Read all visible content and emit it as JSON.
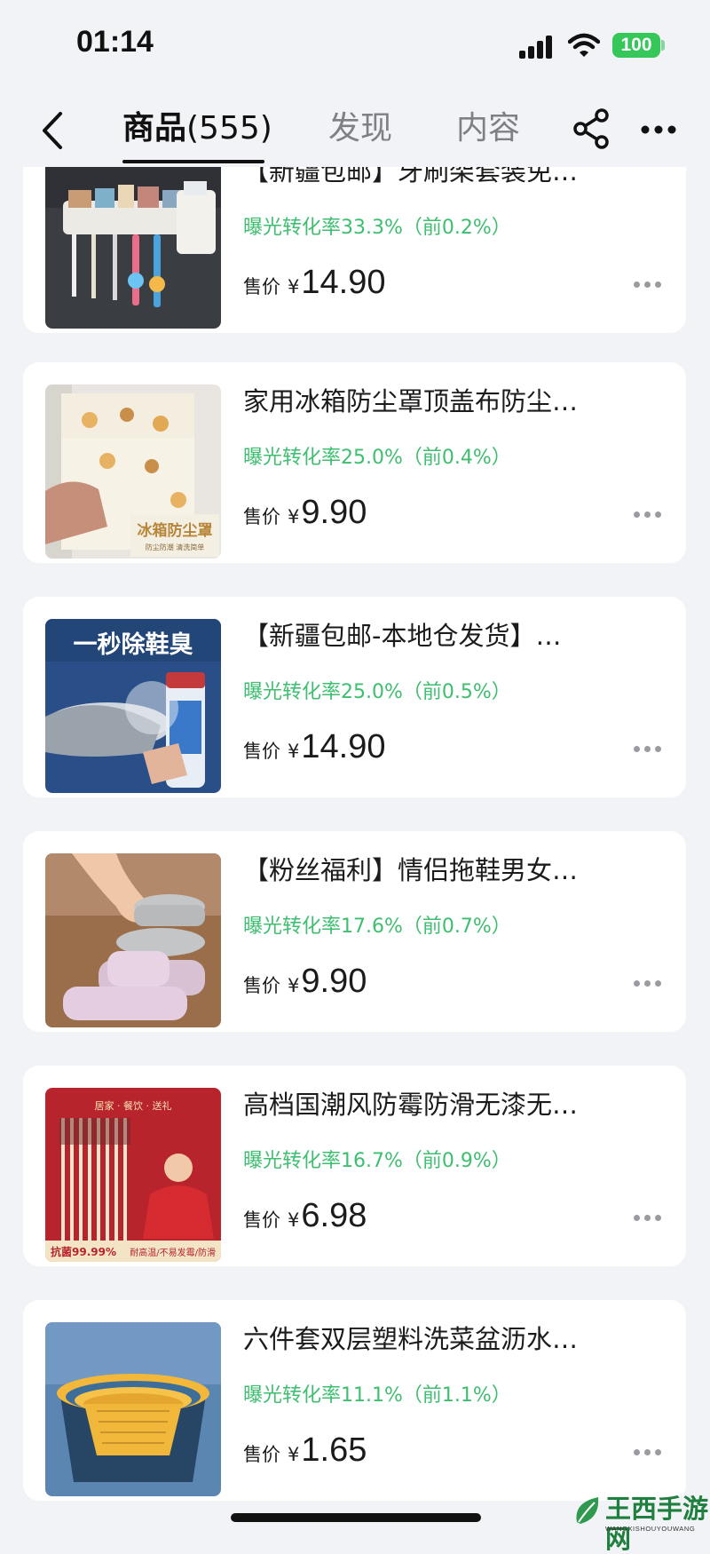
{
  "status_bar": {
    "time": "01:14",
    "battery": "100",
    "icons": [
      "signal-icon",
      "wifi-icon",
      "battery-icon"
    ]
  },
  "nav": {
    "back_icon": "back-chevron-icon",
    "tabs": [
      {
        "label": "商品",
        "count": "(555)",
        "active": true
      },
      {
        "label": "发现",
        "active": false
      },
      {
        "label": "内容",
        "active": false
      }
    ],
    "share_icon": "share-icon",
    "more_icon": "more-icon"
  },
  "colors": {
    "accent_green": "#3ebe6f",
    "background": "#f2f3f6",
    "card": "#ffffff",
    "battery_green": "#35c759"
  },
  "products": [
    {
      "title": "【新疆包邮】牙刷架套装免…",
      "conversion": "曝光转化率33.3%（前0.2%）",
      "price_label": "售价",
      "currency": "¥",
      "price": "14.90",
      "image": "toothbrush-holder"
    },
    {
      "title": "家用冰箱防尘罩顶盖布防尘…",
      "conversion": "曝光转化率25.0%（前0.4%）",
      "price_label": "售价",
      "currency": "¥",
      "price": "9.90",
      "image": "fridge-cover",
      "image_text": [
        "冰箱防尘罩",
        "防尘防潮 清洗简单"
      ]
    },
    {
      "title": "【新疆包邮-本地仓发货】…",
      "conversion": "曝光转化率25.0%（前0.5%）",
      "price_label": "售价",
      "currency": "¥",
      "price": "14.90",
      "image": "shoe-deodorant-spray",
      "image_text": [
        "一秒除鞋臭"
      ]
    },
    {
      "title": "【粉丝福利】情侣拖鞋男女…",
      "conversion": "曝光转化率17.6%（前0.7%）",
      "price_label": "售价",
      "currency": "¥",
      "price": "9.90",
      "image": "slippers"
    },
    {
      "title": "高档国潮风防霉防滑无漆无…",
      "conversion": "曝光转化率16.7%（前0.9%）",
      "price_label": "售价",
      "currency": "¥",
      "price": "6.98",
      "image": "chopsticks",
      "image_text": [
        "居家 · 餐饮 · 送礼",
        "抗菌99.99%",
        "耐高温/不易发霉/防滑"
      ]
    },
    {
      "title": "六件套双层塑料洗菜盆沥水…",
      "conversion": "曝光转化率11.1%（前1.1%）",
      "price_label": "售价",
      "currency": "¥",
      "price": "1.65",
      "image": "colander-set"
    }
  ],
  "watermark": {
    "title": "王西手游网",
    "subtitle": "WANGXISHOUYOUWANG"
  }
}
